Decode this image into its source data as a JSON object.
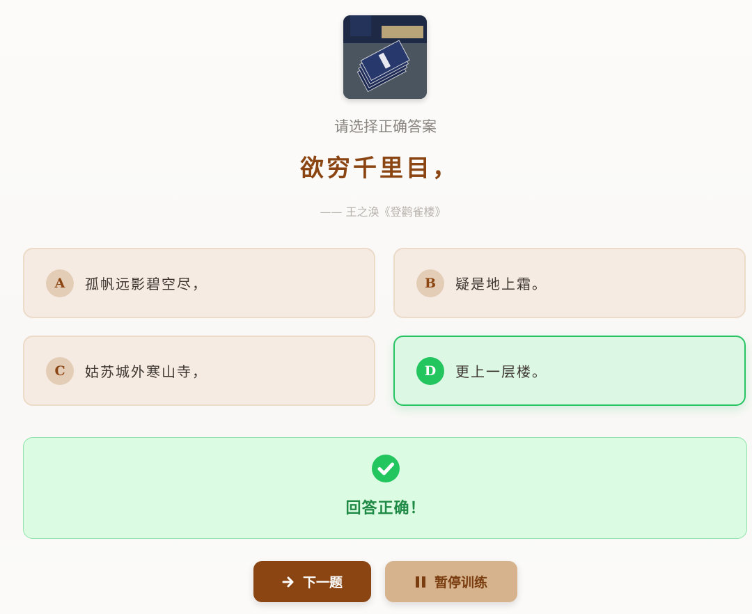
{
  "header": {
    "image_alt": "古籍书卷",
    "prompt": "请选择正确答案",
    "question": "欲穷千里目，",
    "source": "—— 王之涣《登鹳雀楼》"
  },
  "options": [
    {
      "letter": "A",
      "text": "孤帆远影碧空尽，",
      "state": "normal"
    },
    {
      "letter": "B",
      "text": "疑是地上霜。",
      "state": "normal"
    },
    {
      "letter": "C",
      "text": "姑苏城外寒山寺，",
      "state": "normal"
    },
    {
      "letter": "D",
      "text": "更上一层楼。",
      "state": "correct"
    }
  ],
  "feedback": {
    "icon": "check-circle-icon",
    "message": "回答正确！"
  },
  "actions": {
    "next_label": "下一题",
    "next_icon": "arrow-right-icon",
    "pause_label": "暂停训练",
    "pause_icon": "pause-icon"
  },
  "colors": {
    "primary": "#8b4513",
    "correct": "#22c55e",
    "option_bg": "#f5ebe2",
    "feedback_bg": "#dcfbe3"
  }
}
